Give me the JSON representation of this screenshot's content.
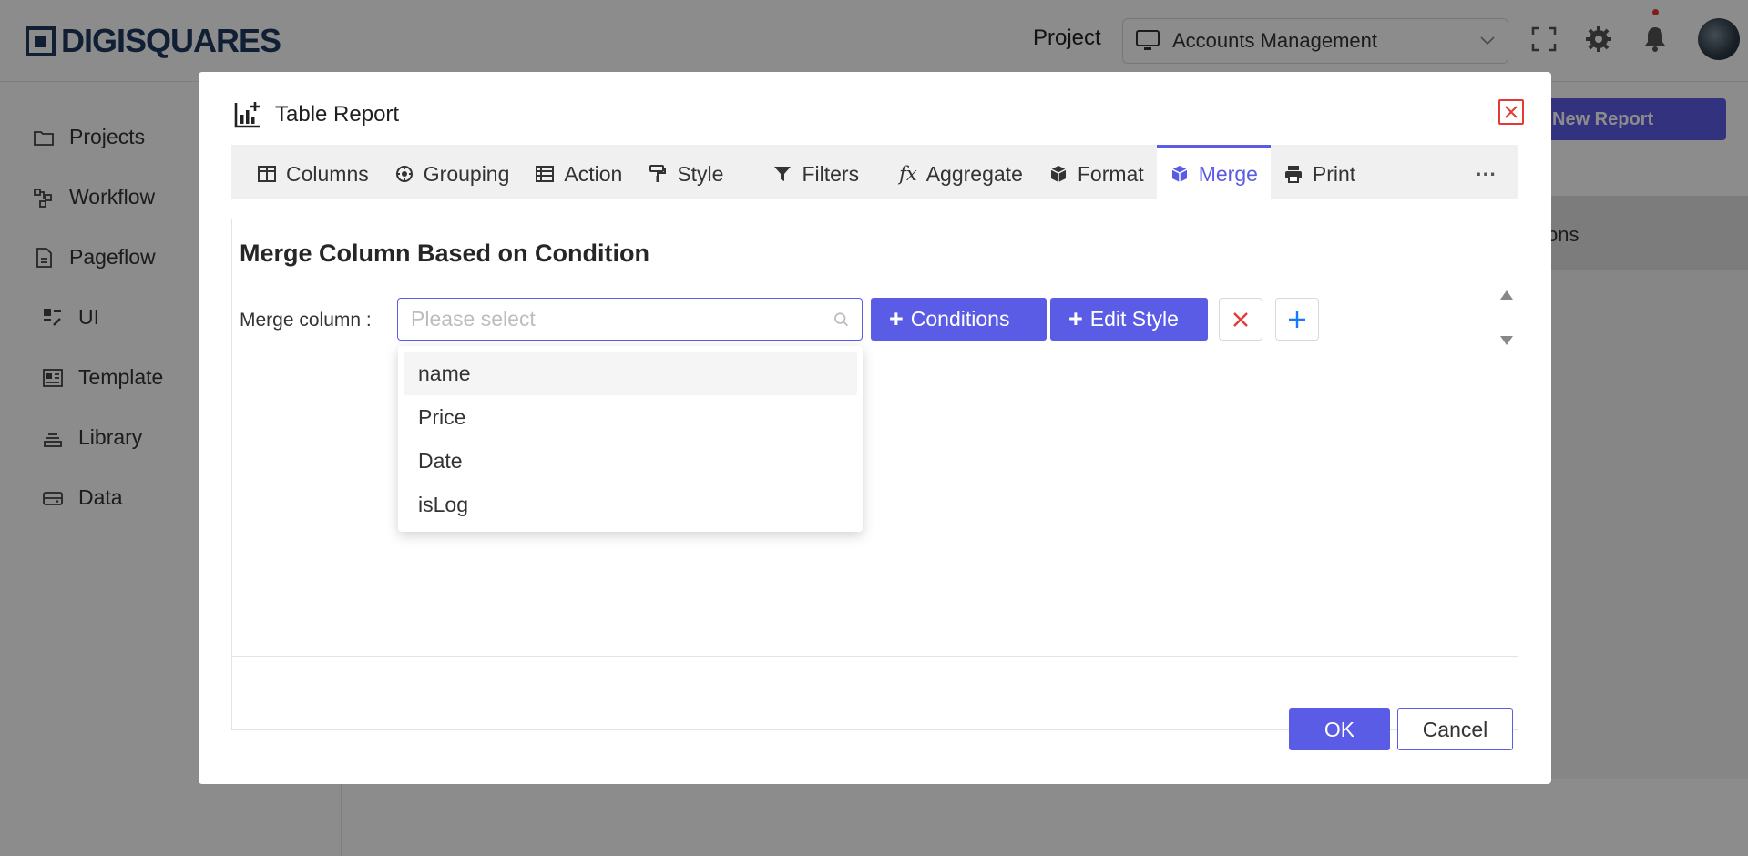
{
  "app": {
    "logo_text": "DIGISQUARES",
    "project_label": "Project",
    "project_value": "Accounts Management",
    "new_report_label": "New Report",
    "background_column_text": "ons"
  },
  "sidebar": {
    "items": [
      {
        "label": "Projects",
        "icon": "folder-icon"
      },
      {
        "label": "Workflow",
        "icon": "workflow-icon"
      },
      {
        "label": "Pageflow",
        "icon": "page-icon"
      },
      {
        "label": "UI",
        "icon": "ui-grid-icon"
      },
      {
        "label": "Template",
        "icon": "template-icon"
      },
      {
        "label": "Library",
        "icon": "library-icon"
      },
      {
        "label": "Data",
        "icon": "data-icon"
      }
    ]
  },
  "modal": {
    "title": "Table Report",
    "tabs": [
      {
        "label": "Columns",
        "icon": "columns-icon"
      },
      {
        "label": "Grouping",
        "icon": "grouping-icon"
      },
      {
        "label": "Action",
        "icon": "action-icon"
      },
      {
        "label": "Style",
        "icon": "paint-roller-icon"
      },
      {
        "label": "Filters",
        "icon": "filter-icon"
      },
      {
        "label": "Aggregate",
        "icon": "fx-icon"
      },
      {
        "label": "Format",
        "icon": "cube-icon"
      },
      {
        "label": "Merge",
        "icon": "merge-cube-icon"
      },
      {
        "label": "Print",
        "icon": "print-icon"
      }
    ],
    "more_label": "···",
    "active_tab": "Merge",
    "section_title": "Merge Column Based on Condition",
    "merge_label": "Merge column :",
    "merge_placeholder": "Please select",
    "conditions_label": "Conditions",
    "edit_style_label": "Edit Style",
    "dropdown_options": [
      "name",
      "Price",
      "Date",
      "isLog"
    ],
    "ok_label": "OK",
    "cancel_label": "Cancel"
  },
  "colors": {
    "accent": "#5b5ce6",
    "danger": "#e53935",
    "brand": "#1e3a5f"
  }
}
